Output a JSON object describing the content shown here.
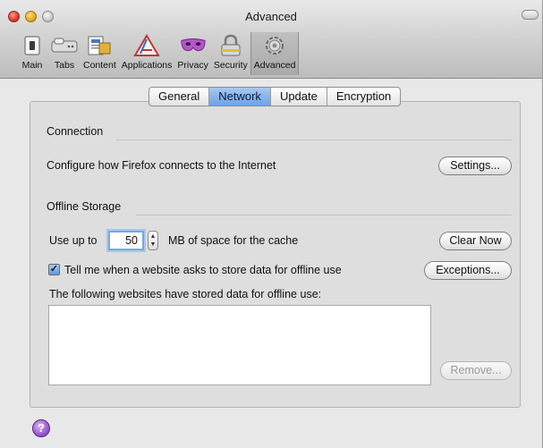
{
  "window": {
    "title": "Advanced"
  },
  "toolbar": {
    "items": [
      {
        "label": "Main",
        "icon": "switch-icon"
      },
      {
        "label": "Tabs",
        "icon": "tabs-icon"
      },
      {
        "label": "Content",
        "icon": "content-icon"
      },
      {
        "label": "Applications",
        "icon": "applications-icon"
      },
      {
        "label": "Privacy",
        "icon": "mask-icon"
      },
      {
        "label": "Security",
        "icon": "lock-icon"
      },
      {
        "label": "Advanced",
        "icon": "gear-icon"
      }
    ],
    "selected": "Advanced"
  },
  "tabs": {
    "items": [
      "General",
      "Network",
      "Update",
      "Encryption"
    ],
    "active": "Network"
  },
  "connection": {
    "title": "Connection",
    "description": "Configure how Firefox connects to the Internet",
    "settings_button": "Settings..."
  },
  "offline": {
    "title": "Offline Storage",
    "use_up_to": "Use up to",
    "cache_value": "50",
    "cache_suffix": "MB of space for the cache",
    "clear_now_button": "Clear Now",
    "tell_me_label": "Tell me when a website asks to store data for offline use",
    "tell_me_checked": true,
    "check_mark": "✓",
    "exceptions_button": "Exceptions...",
    "list_label": "The following websites have stored data for offline use:",
    "remove_button": "Remove..."
  },
  "help": {
    "glyph": "?"
  },
  "colors": {
    "selection": "#6da3e6",
    "help": "#9a5bd1"
  }
}
